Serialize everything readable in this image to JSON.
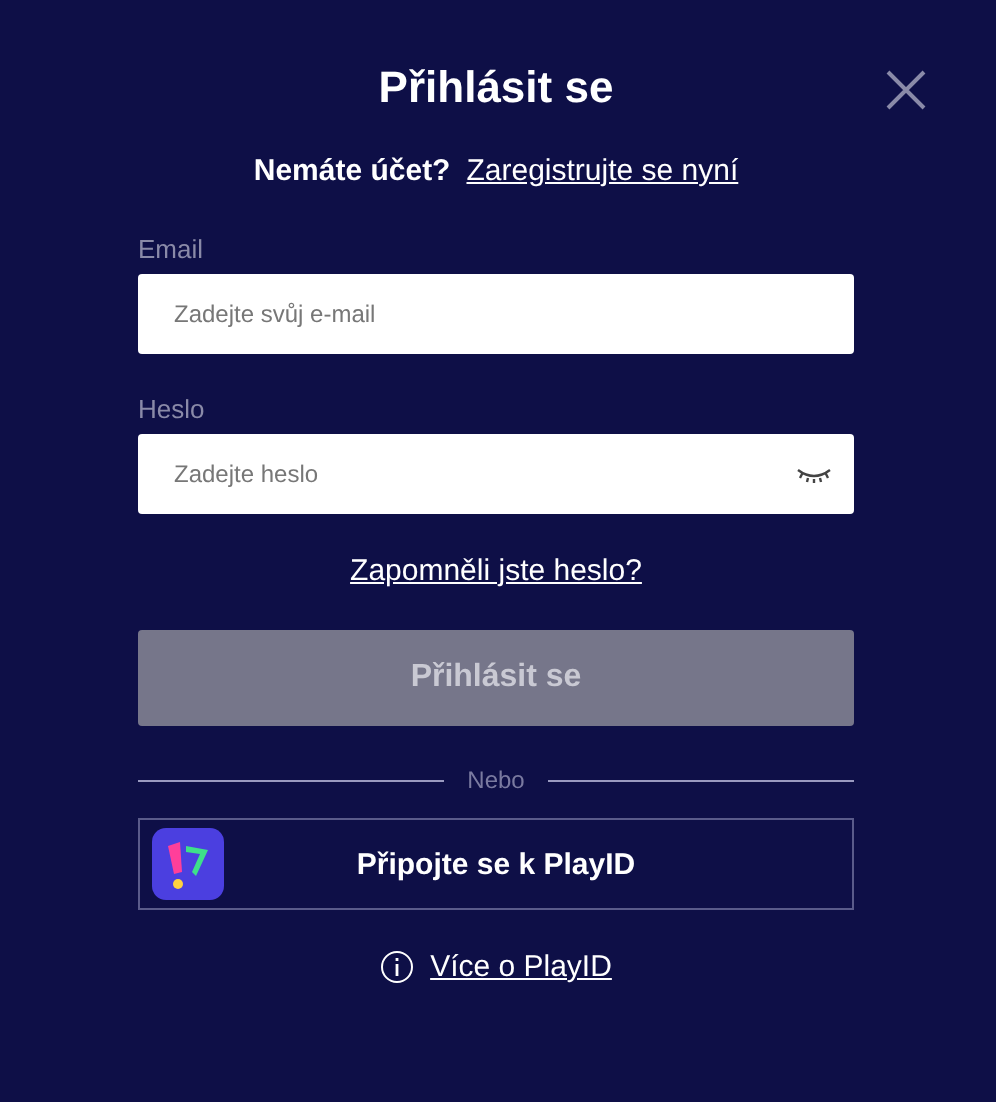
{
  "dialog": {
    "title": "Přihlásit se",
    "register_prompt": "Nemáte účet?",
    "register_link": "Zaregistrujte se nyní"
  },
  "fields": [
    {
      "label": "Email",
      "placeholder": "Zadejte svůj e-mail",
      "kind": "email"
    },
    {
      "label": "Heslo",
      "placeholder": "Zadejte heslo",
      "kind": "password"
    }
  ],
  "forgot_link": "Zapomněli jste heslo?",
  "submit": {
    "label": "Přihlásit se",
    "disabled": true
  },
  "divider": "Nebo",
  "playid_button": "Připojte se k PlayID",
  "info_link": "Více o PlayID"
}
